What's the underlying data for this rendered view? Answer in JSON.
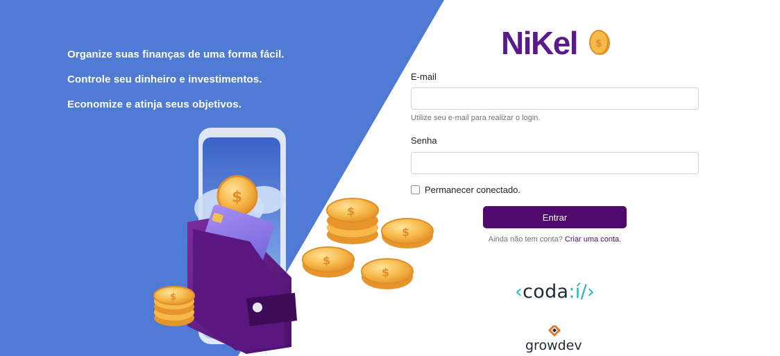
{
  "left_panel": {
    "slogans": [
      "Organize suas finanças de uma forma fácil.",
      "Controle seu dinheiro e investimentos.",
      "Economize e atinja seus objetivos."
    ],
    "illustration": "wallet-phone-coins-illustration",
    "background_color": "#4f7bd4"
  },
  "brand": {
    "name": "NiKel",
    "color": "#5b1a8b"
  },
  "login_form": {
    "email_label": "E-mail",
    "email_value": "",
    "email_help": "Utilize seu e-mail para realizar o login.",
    "password_label": "Senha",
    "password_value": "",
    "remember_label": "Permanecer conectado.",
    "remember_checked": false,
    "submit_label": "Entrar",
    "register_prompt": "Ainda não tem conta?",
    "register_link": "Criar uma conta.",
    "button_color": "#4f0a6b"
  },
  "partners": {
    "coda_open": "‹",
    "coda_text": "coda",
    "coda_sep": ":",
    "coda_i": "í",
    "coda_close": "/›",
    "growdev_grow": "grow",
    "growdev_dev": "dev"
  }
}
